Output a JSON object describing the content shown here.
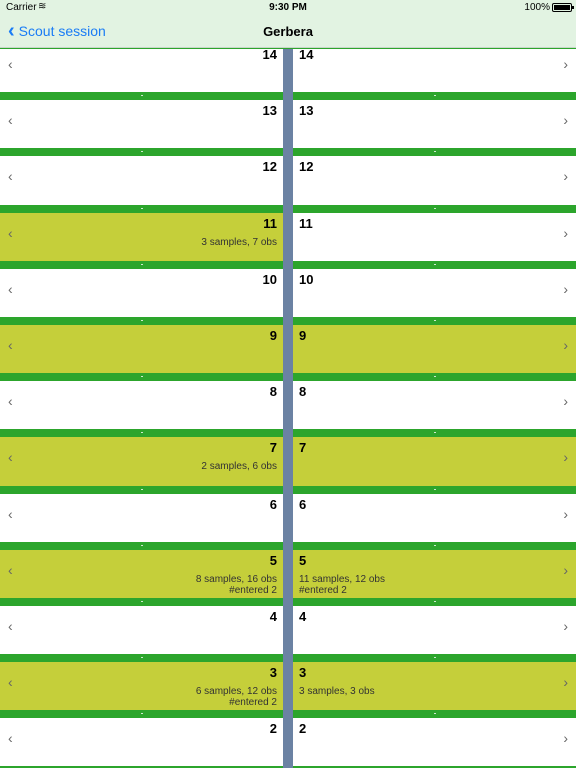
{
  "status_bar": {
    "carrier": "Carrier",
    "time": "9:30 PM",
    "battery": "100%"
  },
  "nav": {
    "back_label": "Scout session",
    "title": "Gerbera"
  },
  "rows": [
    {
      "number": "14",
      "left": {
        "active": false,
        "lines": []
      },
      "right": {
        "active": false,
        "lines": []
      }
    },
    {
      "number": "13",
      "left": {
        "active": false,
        "lines": []
      },
      "right": {
        "active": false,
        "lines": []
      }
    },
    {
      "number": "12",
      "left": {
        "active": false,
        "lines": []
      },
      "right": {
        "active": false,
        "lines": []
      }
    },
    {
      "number": "11",
      "left": {
        "active": true,
        "lines": [
          "3 samples, 7 obs"
        ]
      },
      "right": {
        "active": false,
        "lines": []
      }
    },
    {
      "number": "10",
      "left": {
        "active": false,
        "lines": []
      },
      "right": {
        "active": false,
        "lines": []
      }
    },
    {
      "number": "9",
      "left": {
        "active": true,
        "lines": []
      },
      "right": {
        "active": true,
        "lines": []
      }
    },
    {
      "number": "8",
      "left": {
        "active": false,
        "lines": []
      },
      "right": {
        "active": false,
        "lines": []
      }
    },
    {
      "number": "7",
      "left": {
        "active": true,
        "lines": [
          "2 samples, 6 obs"
        ]
      },
      "right": {
        "active": true,
        "lines": []
      }
    },
    {
      "number": "6",
      "left": {
        "active": false,
        "lines": []
      },
      "right": {
        "active": false,
        "lines": []
      }
    },
    {
      "number": "5",
      "left": {
        "active": true,
        "lines": [
          "8 samples, 16 obs",
          "#entered 2"
        ]
      },
      "right": {
        "active": true,
        "lines": [
          "11 samples, 12 obs",
          "#entered 2"
        ]
      }
    },
    {
      "number": "4",
      "left": {
        "active": false,
        "lines": []
      },
      "right": {
        "active": false,
        "lines": []
      }
    },
    {
      "number": "3",
      "left": {
        "active": true,
        "lines": [
          "6 samples, 12 obs",
          "#entered 2"
        ]
      },
      "right": {
        "active": true,
        "lines": [
          "3 samples, 3 obs"
        ]
      }
    },
    {
      "number": "2",
      "left": {
        "active": false,
        "lines": []
      },
      "right": {
        "active": false,
        "lines": []
      }
    }
  ],
  "icons": {
    "back": "chevron-left-icon",
    "row_left": "chevron-left-icon",
    "row_right": "chevron-right-icon",
    "wifi": "wifi-icon",
    "battery": "battery-icon"
  },
  "colors": {
    "separator": "#2ca52c",
    "active": "#c5cf3a",
    "divider": "#6b82a3",
    "tint": "#1a7cf5",
    "bar": "#e2f3e2"
  }
}
